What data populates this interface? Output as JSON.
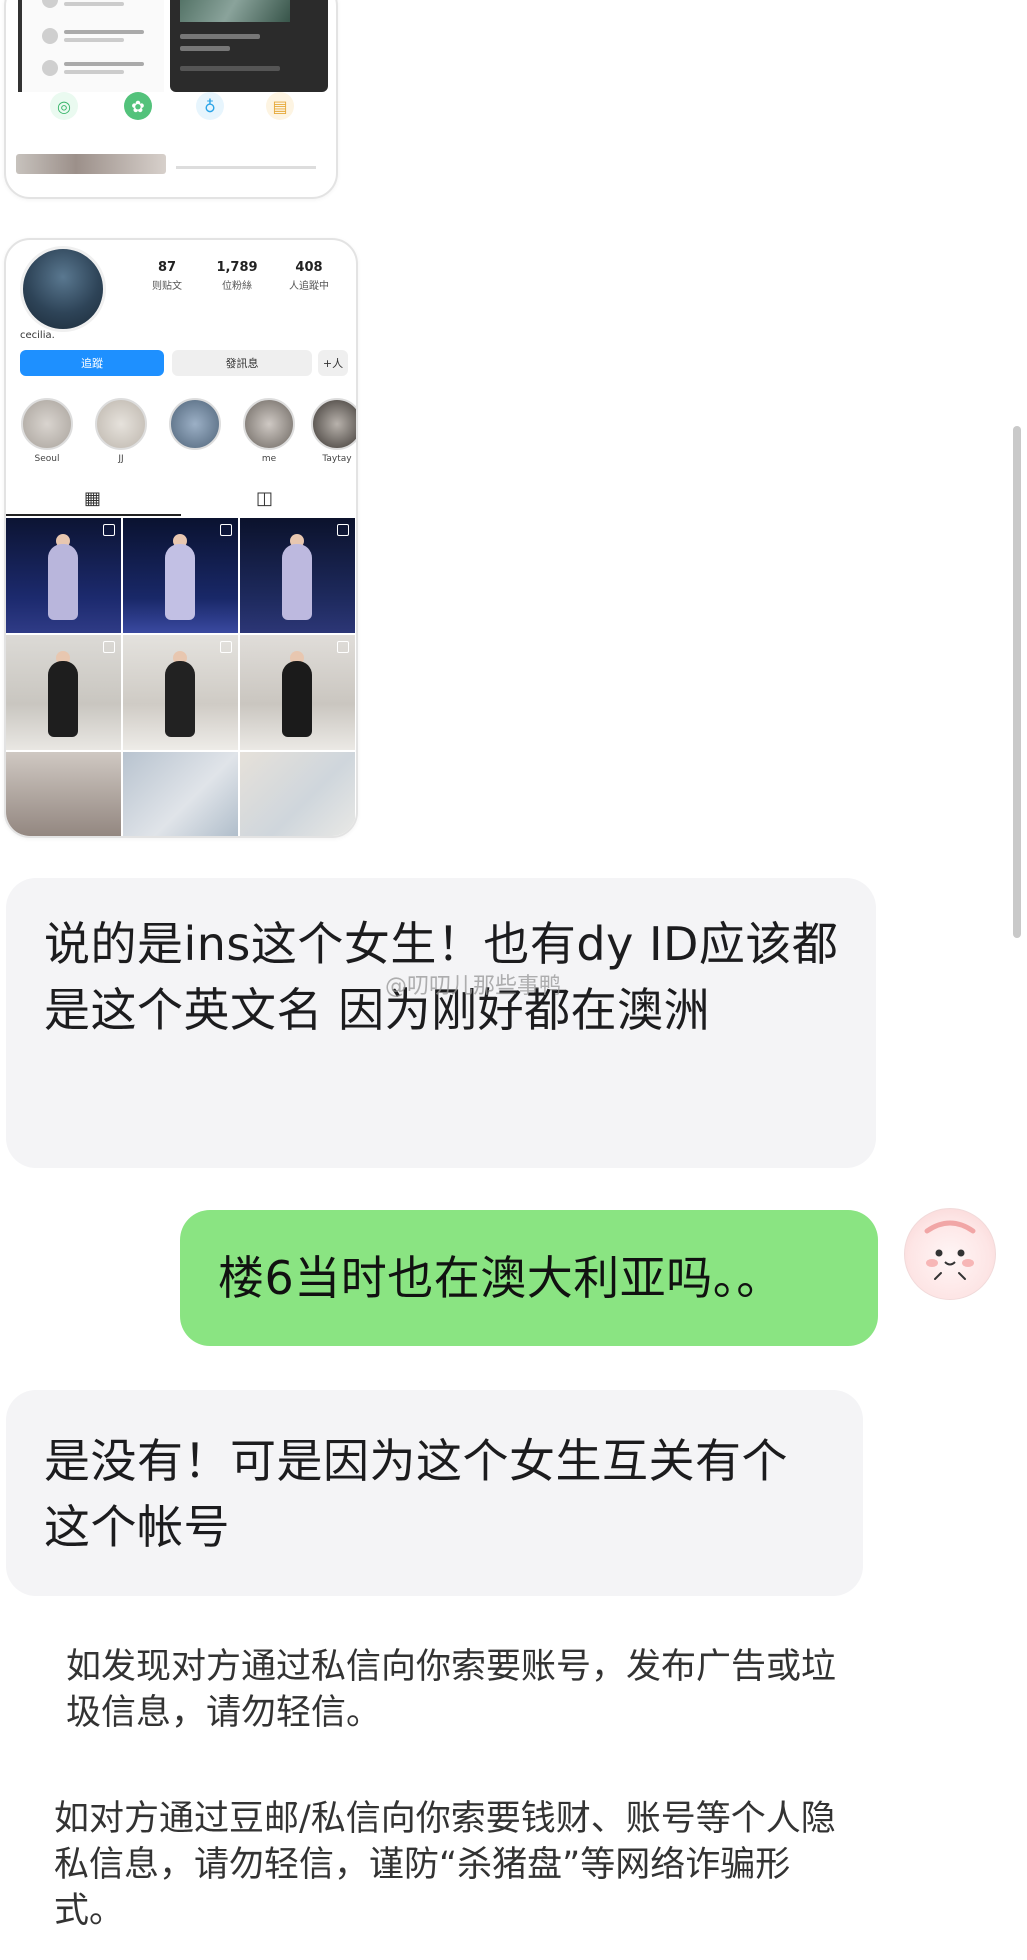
{
  "messages": [
    {
      "side": "left",
      "text": "说的是ins这个女生！也有dy ID应该都是这个英文名 因为刚好都在澳洲"
    },
    {
      "side": "right",
      "text": "楼6当时也在澳大利亚吗。。"
    },
    {
      "side": "left",
      "text": "是没有！可是因为这个女生互关有个这个帐号"
    }
  ],
  "watermark": "@叨叨儿那些事鸭",
  "notices": [
    "如发现对方通过私信向你索要账号，发布广告或垃圾信息，请勿轻信。",
    "如对方通过豆邮/私信向你索要钱财、账号等个人隐私信息，请勿轻信，谨防“杀猪盘”等网络诈骗形式。"
  ],
  "ig_profile": {
    "stats": [
      {
        "value": "87",
        "label": "则贴文"
      },
      {
        "value": "1,789",
        "label": "位粉絲"
      },
      {
        "value": "408",
        "label": "人追蹤中"
      }
    ],
    "username": "cecilia.",
    "follow_label": "追蹤",
    "message_label": "發訊息",
    "add_label": "+人",
    "highlights": [
      "Seoul",
      "JJ",
      "",
      "me",
      "Taytay"
    ]
  },
  "colors": {
    "left_bubble": "#f4f4f6",
    "right_bubble": "#8ae482",
    "follow_button": "#1e90ff"
  }
}
